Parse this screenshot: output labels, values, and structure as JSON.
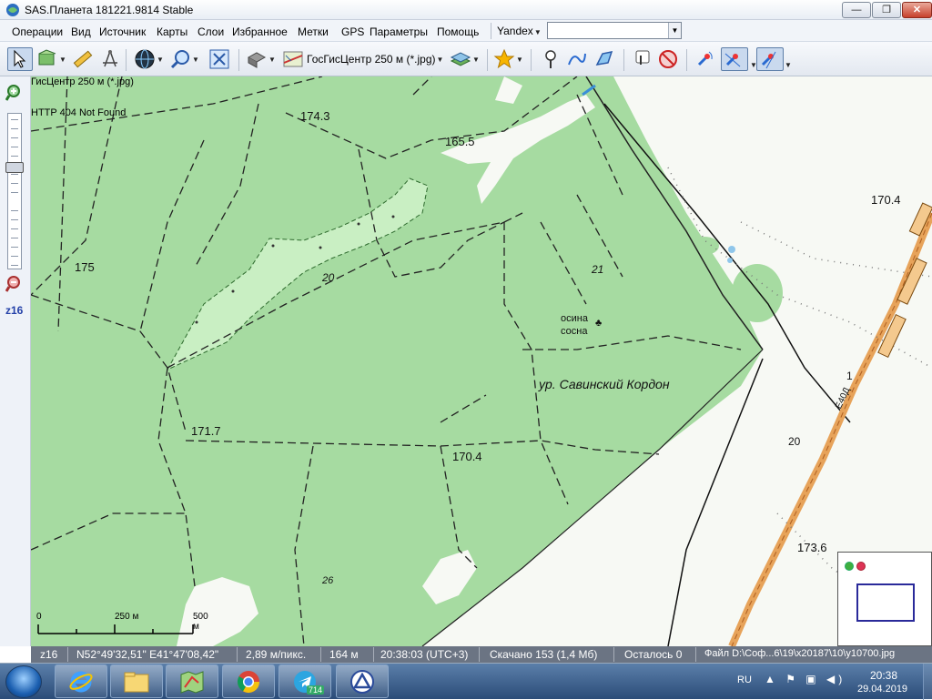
{
  "window": {
    "title": "SAS.Планета 181221.9814 Stable",
    "min": "—",
    "max": "❐",
    "close": "✕"
  },
  "menu": {
    "items": [
      "Операции",
      "Вид",
      "Источник",
      "Карты",
      "Слои",
      "Избранное",
      "Метки",
      "GPS",
      "Параметры",
      "Помощь"
    ],
    "provider": "Yandex",
    "search_value": ""
  },
  "toolbar": {
    "map_source": "ГосГисЦентр 250 м (*.jpg)"
  },
  "map": {
    "overlay_source": "ГисЦентр 250 м (*.jpg)",
    "overlay_error": "HTTP 404 Not Found",
    "labels": {
      "h1743": "174.3",
      "h1655": "165.5",
      "h175": "175",
      "n20a": "20",
      "n21": "21",
      "osina": "осина",
      "sosna": "сосна",
      "urochishe": "ур. Савинский Кордон",
      "h1717": "171.7",
      "h1704a": "170.4",
      "h1704b": "170.4",
      "h1736": "173.6",
      "n1": "1",
      "n20b": "20",
      "n26": "26",
      "road": "Е40Д"
    },
    "scale": {
      "t0": "0",
      "t250": "250 м",
      "t500": "500 м"
    }
  },
  "status": {
    "zoom": "z16",
    "coords": "N52°49'32,51\" E41°47'08,42\"",
    "resolution": "2,89 м/пикс.",
    "distance": "164 м",
    "time": "20:38:03 (UTC+3)",
    "downloaded": "Скачано 153 (1,4 Мб)",
    "remaining": "Осталось 0",
    "file": "Файл D:\\Соф...6\\19\\x20187\\10\\y10700.jpg"
  },
  "side": {
    "zoom_level": "z16"
  },
  "taskbar": {
    "telegram_badge": "714",
    "lang": "RU",
    "time": "20:38",
    "date": "29.04.2019"
  }
}
